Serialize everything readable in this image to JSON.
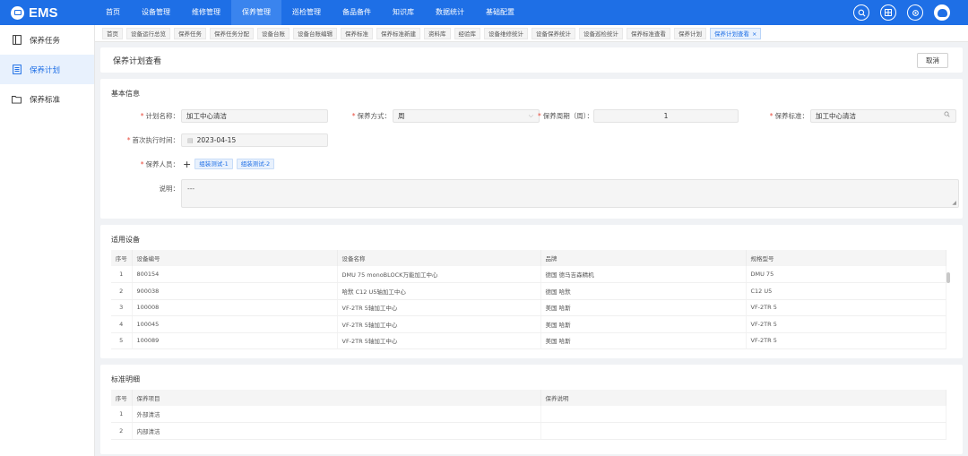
{
  "app": {
    "name": "EMS"
  },
  "topnav": [
    "首页",
    "设备管理",
    "维修管理",
    "保养管理",
    "巡检管理",
    "备品备件",
    "知识库",
    "数据统计",
    "基础配置"
  ],
  "top_icons": [
    "search-icon",
    "grid-icon",
    "settings-icon",
    "user-avatar-icon"
  ],
  "sidebar": [
    {
      "label": "保养任务",
      "icon": "task-icon"
    },
    {
      "label": "保养计划",
      "icon": "plan-icon",
      "active": true
    },
    {
      "label": "保养标准",
      "icon": "folder-icon"
    }
  ],
  "tabs": [
    "首页",
    "设备运行总览",
    "保养任务",
    "保养任务分配",
    "设备台账",
    "设备台账编辑",
    "保养标准",
    "保养标准新建",
    "资料库",
    "经验库",
    "设备维修统计",
    "设备保养统计",
    "设备巡检统计",
    "保养标准查看",
    "保养计划",
    "保养计划查看"
  ],
  "active_tab_close": "×",
  "page": {
    "title": "保养计划查看",
    "cancel_label": "取消"
  },
  "basic": {
    "section_title": "基本信息",
    "plan_name_label": "计划名称：",
    "plan_name": "加工中心清洁",
    "method_label": "保养方式：",
    "method": "周",
    "cycle_label": "保养周期（周）：",
    "cycle": "1",
    "standard_label": "保养标准：",
    "standard": "加工中心清洁",
    "first_time_label": "首次执行时间：",
    "first_time": "2023-04-15",
    "staff_label": "保养人员：",
    "staff": [
      "组装测试-1",
      "组装测试-2"
    ],
    "desc_label": "说明：",
    "desc": "---",
    "required_mark": "*"
  },
  "equipment": {
    "section_title": "适用设备",
    "columns": [
      "序号",
      "设备编号",
      "设备名称",
      "品牌",
      "规格型号"
    ],
    "rows": [
      [
        "1",
        "800154",
        "DMU 75 monoBLOCK万能加工中心",
        "德国 德马吉森精机",
        "DMU 75"
      ],
      [
        "2",
        "900038",
        "哈默 C12 U5轴加工中心",
        "德国 哈默",
        "C12 U5"
      ],
      [
        "3",
        "100008",
        "VF-2TR 5轴加工中心",
        "美国 哈斯",
        "VF-2TR 5"
      ],
      [
        "4",
        "100045",
        "VF-2TR 5轴加工中心",
        "美国 哈斯",
        "VF-2TR 5"
      ],
      [
        "5",
        "100089",
        "VF-2TR 5轴加工中心",
        "美国 哈斯",
        "VF-2TR 5"
      ]
    ]
  },
  "standard_detail": {
    "section_title": "标准明细",
    "columns": [
      "序号",
      "保养项目",
      "保养说明"
    ],
    "rows": [
      [
        "1",
        "外部清洁",
        ""
      ],
      [
        "2",
        "内部清洁",
        ""
      ]
    ]
  },
  "colors": {
    "primary": "#1e6fe6",
    "required": "#e84b3c"
  }
}
